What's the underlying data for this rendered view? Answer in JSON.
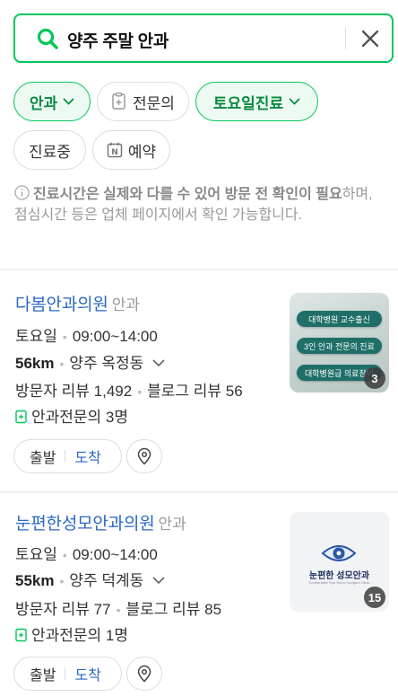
{
  "search": {
    "query": "양주 주말 안과"
  },
  "filters": [
    {
      "label": "안과",
      "active": true
    },
    {
      "label": "전문의",
      "active": false
    },
    {
      "label": "토요일진료",
      "active": true
    },
    {
      "label": "진료중",
      "active": false
    },
    {
      "label": "예약",
      "active": false
    }
  ],
  "notice": {
    "bold": "진료시간은 실제와 다를 수 있어 방문 전 확인이 필요",
    "rest": "하며, 점심시간 등은 업체 페이지에서 확인 가능합니다."
  },
  "results": [
    {
      "name": "다봄안과의원",
      "category": "안과",
      "day": "토요일",
      "hours": "09:00~14:00",
      "distance": "56km",
      "location": "양주 옥정동",
      "visitor_reviews": "방문자 리뷰 1,492",
      "blog_reviews": "블로그 리뷰 56",
      "specialists": "안과전문의 3명",
      "photo_count": "3",
      "photo_pills": [
        "대학병원 교수출신",
        "3인 안과 전문의 진료",
        "대학병원급 의료장비"
      ],
      "btn_depart": "출발",
      "btn_arrive": "도착"
    },
    {
      "name": "눈편한성모안과의원",
      "category": "안과",
      "day": "토요일",
      "hours": "09:00~14:00",
      "distance": "55km",
      "location": "양주 덕계동",
      "visitor_reviews": "방문자 리뷰 77",
      "blog_reviews": "블로그 리뷰 85",
      "specialists": "안과전문의 1명",
      "photo_count": "15",
      "logo_text": "눈편한 성모안과",
      "logo_sub": "Comfortable Eye Seoul Sungmo Clinic",
      "btn_depart": "출발",
      "btn_arrive": "도착"
    }
  ],
  "colors": {
    "brand_green": "#03c75a",
    "link_blue": "#2a67c4"
  }
}
